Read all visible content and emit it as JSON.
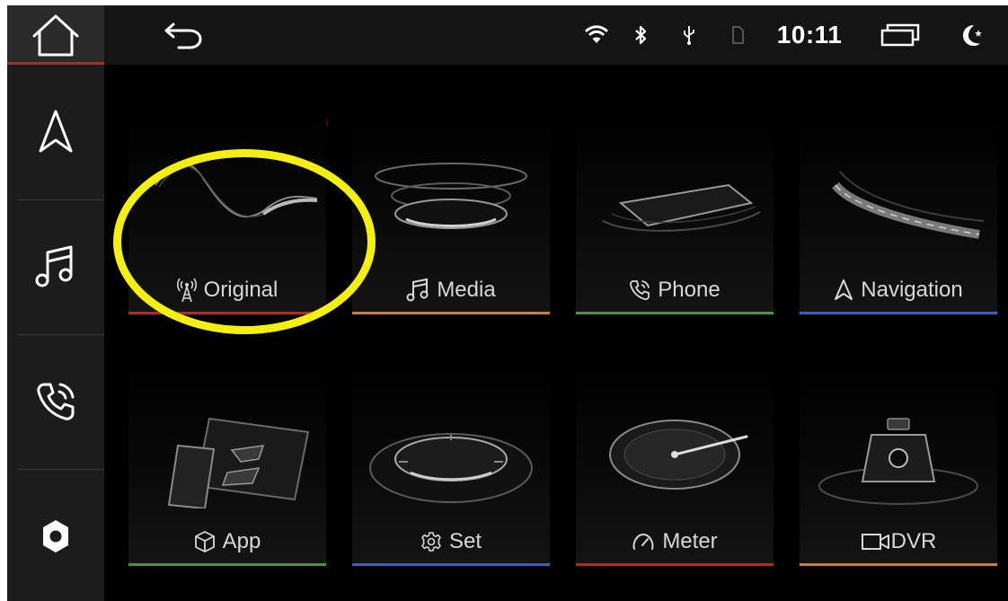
{
  "statusbar": {
    "time": "10:11",
    "icons": [
      "back-arrow-icon",
      "wifi-icon",
      "bluetooth-icon",
      "usb-icon",
      "sim-card-icon",
      "recent-apps-icon",
      "night-mode-icon"
    ]
  },
  "sidebar": {
    "home_accent": "#c81e1e",
    "items": [
      {
        "name": "home",
        "icon": "home-icon"
      },
      {
        "name": "navigation",
        "icon": "navigation-arrow-icon"
      },
      {
        "name": "music",
        "icon": "music-note-icon"
      },
      {
        "name": "phone",
        "icon": "phone-icon"
      },
      {
        "name": "settings",
        "icon": "gear-icon"
      }
    ]
  },
  "tiles": [
    {
      "id": "original",
      "label": "Original",
      "icon": "radio-tower-icon",
      "accent": "#c8201e"
    },
    {
      "id": "media",
      "label": "Media",
      "icon": "music-note-icon",
      "accent": "#e07a1a"
    },
    {
      "id": "phone",
      "label": "Phone",
      "icon": "phone-icon",
      "accent": "#3aa12a"
    },
    {
      "id": "navigation",
      "label": "Navigation",
      "icon": "navigation-arrow-icon",
      "accent": "#2a62d8"
    },
    {
      "id": "app",
      "label": "App",
      "icon": "cube-icon",
      "accent": "#3aa12a"
    },
    {
      "id": "set",
      "label": "Set",
      "icon": "gear-icon",
      "accent": "#2a62d8"
    },
    {
      "id": "meter",
      "label": "Meter",
      "icon": "speedometer-icon",
      "accent": "#c8201e"
    },
    {
      "id": "dvr",
      "label": "DVR",
      "icon": "video-camera-icon",
      "accent": "#e07a1a"
    }
  ],
  "annotation": {
    "color": "#f4ef0f",
    "target": "original"
  }
}
